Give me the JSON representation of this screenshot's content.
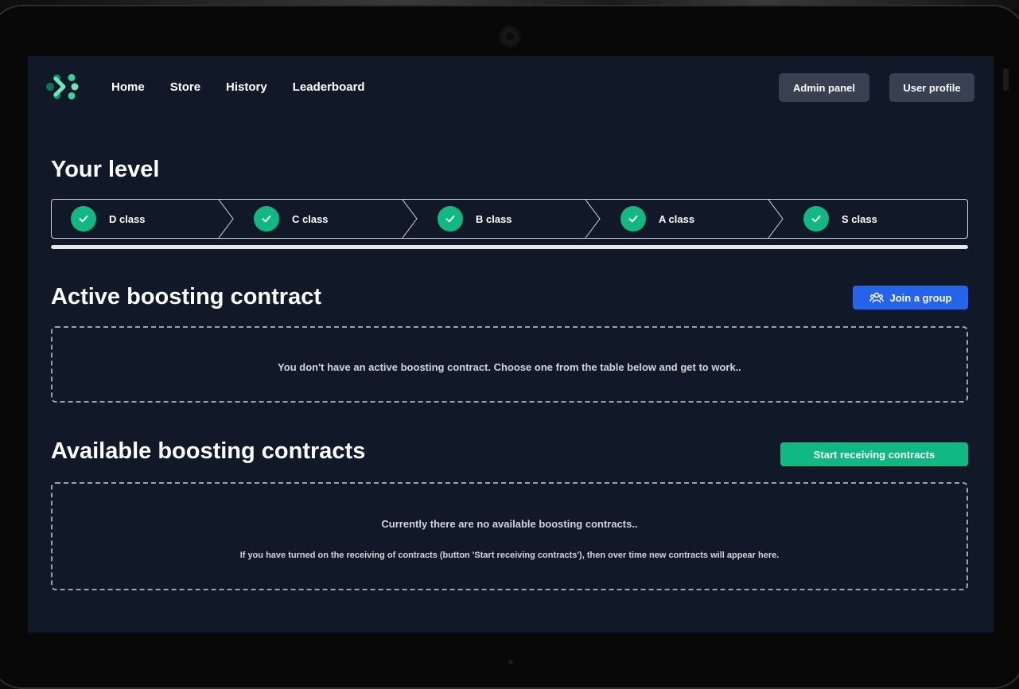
{
  "nav": {
    "links": [
      "Home",
      "Store",
      "History",
      "Leaderboard"
    ],
    "admin_label": "Admin panel",
    "profile_label": "User profile"
  },
  "level": {
    "title": "Your level",
    "steps": [
      "D class",
      "C class",
      "B class",
      "A class",
      "S class"
    ],
    "completed_steps": 5,
    "progress_fraction": 1.0
  },
  "active": {
    "title": "Active boosting contract",
    "join_label": "Join a group",
    "empty_text": "You don't have an active boosting contract. Choose one from the table below and get to work.."
  },
  "available": {
    "title": "Available boosting contracts",
    "start_label": "Start receiving contracts",
    "empty_text": "Currently there are no available boosting contracts..",
    "hint_text": "If you have turned on the receiving of contracts (button 'Start receiving contracts'), then over time new contracts will appear here."
  },
  "colors": {
    "background": "#111827",
    "accent_green": "#10b981",
    "accent_blue": "#2563eb",
    "button_gray": "#374151"
  },
  "icons": {
    "logo": "brand-logo-icon",
    "step": "check-icon",
    "join": "users-group-icon"
  }
}
